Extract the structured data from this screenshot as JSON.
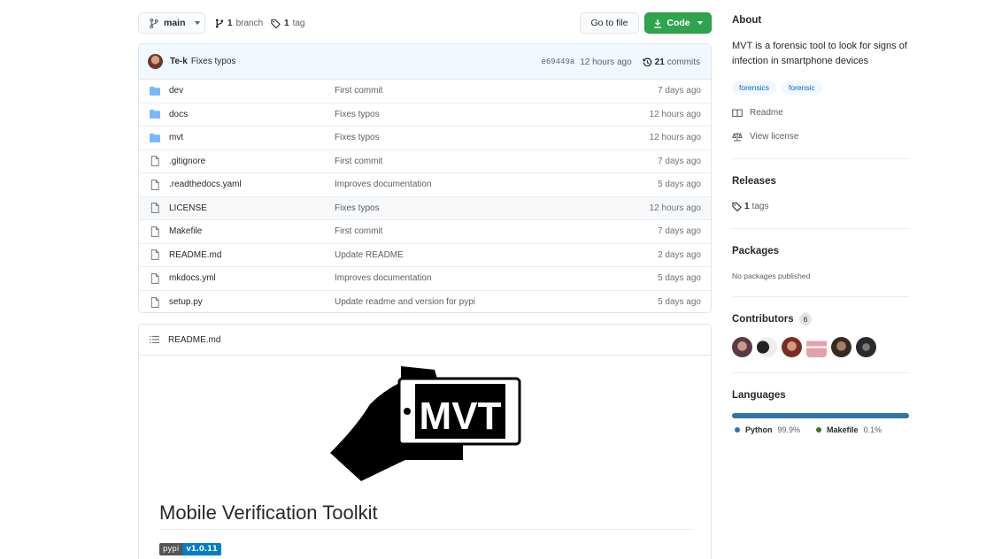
{
  "topbar": {
    "branch_button_label": "main",
    "branch_count": "1",
    "branch_word": "branch",
    "tag_count": "1",
    "tag_word": "tag",
    "go_to_file_label": "Go to file",
    "code_label": "Code"
  },
  "latest_commit": {
    "author": "Te-k",
    "message": "Fixes typos",
    "sha": "e69449a",
    "time": "12 hours ago",
    "commit_count": "21",
    "commit_word": "commits"
  },
  "files": [
    {
      "name": "dev",
      "type": "folder",
      "commit": "First commit",
      "age": "7 days ago"
    },
    {
      "name": "docs",
      "type": "folder",
      "commit": "Fixes typos",
      "age": "12 hours ago"
    },
    {
      "name": "mvt",
      "type": "folder",
      "commit": "Fixes typos",
      "age": "12 hours ago"
    },
    {
      "name": ".gitignore",
      "type": "file",
      "commit": "First commit",
      "age": "7 days ago"
    },
    {
      "name": ".readthedocs.yaml",
      "type": "file",
      "commit": "Improves documentation",
      "age": "5 days ago"
    },
    {
      "name": "LICENSE",
      "type": "file",
      "commit": "Fixes typos",
      "age": "12 hours ago"
    },
    {
      "name": "Makefile",
      "type": "file",
      "commit": "First commit",
      "age": "7 days ago"
    },
    {
      "name": "README.md",
      "type": "file",
      "commit": "Update README",
      "age": "2 days ago"
    },
    {
      "name": "mkdocs.yml",
      "type": "file",
      "commit": "Improves documentation",
      "age": "5 days ago"
    },
    {
      "name": "setup.py",
      "type": "file",
      "commit": "Update readme and version for pypi",
      "age": "5 days ago"
    }
  ],
  "readme": {
    "filename": "README.md",
    "logo_text": "MVT",
    "title": "Mobile Verification Toolkit",
    "badge_label": "pypi",
    "badge_value": "v1.0.11"
  },
  "sidebar": {
    "about_heading": "About",
    "description": "MVT is a forensic tool to look for signs of infection in smartphone devices",
    "topics": [
      "forensics",
      "forensic"
    ],
    "readme_link": "Readme",
    "license_link": "View license",
    "releases_heading": "Releases",
    "releases_tag_count": "1",
    "releases_tag_word": "tags",
    "packages_heading": "Packages",
    "packages_empty": "No packages published",
    "contributors_heading": "Contributors",
    "contributors_count": "6",
    "languages_heading": "Languages",
    "languages": [
      {
        "name": "Python",
        "percent": "99.9%",
        "share": 99.9,
        "color": "#3572A5"
      },
      {
        "name": "Makefile",
        "percent": "0.1%",
        "share": 0.1,
        "color": "#427819"
      }
    ]
  },
  "colors": {
    "code_button": "#2ea44f",
    "folder_icon": "#79b8ff",
    "topic_bg": "#f1f8ff",
    "topic_text": "#0366d6"
  }
}
